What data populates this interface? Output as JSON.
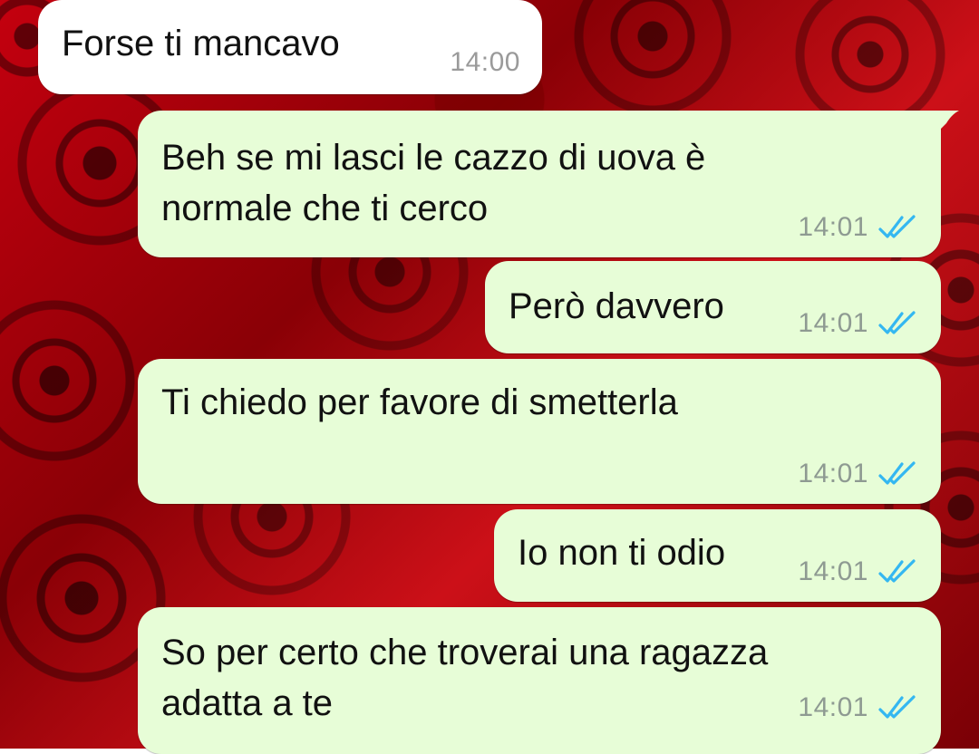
{
  "chat": {
    "messages": [
      {
        "direction": "incoming",
        "text": "Forse ti mancavo",
        "time": "14:00"
      },
      {
        "direction": "outgoing",
        "text": "Beh se mi lasci le cazzo di uova è\nnormale che ti cerco",
        "time": "14:01",
        "status_icon": "double-check-read-icon"
      },
      {
        "direction": "outgoing",
        "text": "Però davvero",
        "time": "14:01",
        "status_icon": "double-check-read-icon"
      },
      {
        "direction": "outgoing",
        "text": "Ti chiedo per favore di smetterla",
        "time": "14:01",
        "status_icon": "double-check-read-icon"
      },
      {
        "direction": "outgoing",
        "text": "Io non ti odio",
        "time": "14:01",
        "status_icon": "double-check-read-icon"
      },
      {
        "direction": "outgoing",
        "text": "So per certo che troverai una ragazza\nadatta a te",
        "time": "14:01",
        "status_icon": "double-check-read-icon"
      }
    ]
  },
  "colors": {
    "incoming_bubble": "#ffffff",
    "outgoing_bubble": "#e7fdd7",
    "read_check": "#34b7f1",
    "wallpaper": "#b0000a"
  }
}
